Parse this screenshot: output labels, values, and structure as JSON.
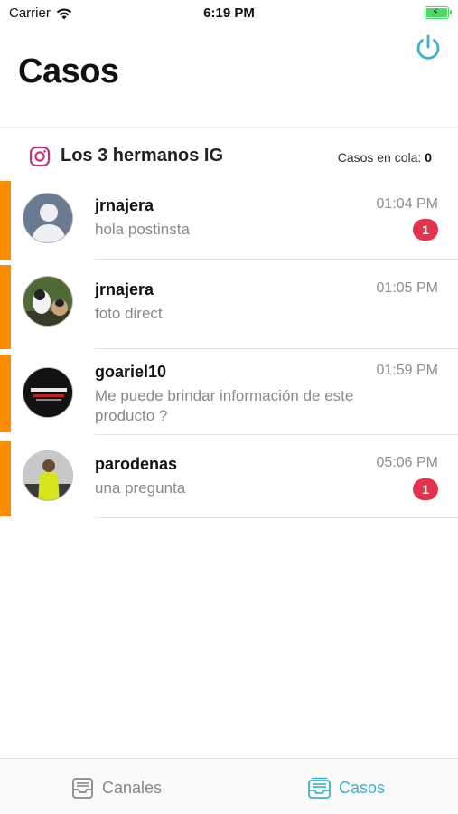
{
  "status_bar": {
    "carrier": "Carrier",
    "time": "6:19 PM"
  },
  "header": {
    "title": "Casos",
    "power_icon": "power-icon"
  },
  "channel": {
    "name": "Los 3 hermanos IG",
    "icon": "instagram-icon",
    "queue_label": "Casos en cola:",
    "queue_count": "0"
  },
  "cases": [
    {
      "name": "jrnajera",
      "time": "01:04 PM",
      "message": "hola postinsta",
      "badge": "1",
      "avatar": "default-avatar"
    },
    {
      "name": "jrnajera",
      "time": "01:05 PM",
      "message": "foto direct",
      "badge": "",
      "avatar": "dog-photo-avatar"
    },
    {
      "name": "goariel10",
      "time": "01:59 PM",
      "message": "Me puede brindar información de este producto ?",
      "badge": "",
      "avatar": "logo-photo-avatar"
    },
    {
      "name": "parodenas",
      "time": "05:06 PM",
      "message": "una pregunta",
      "badge": "1",
      "avatar": "person-photo-avatar"
    }
  ],
  "tabs": [
    {
      "label": "Canales",
      "icon": "inbox-icon",
      "active": false
    },
    {
      "label": "Casos",
      "icon": "inbox-stack-icon",
      "active": true
    }
  ],
  "colors": {
    "accent": "#3ab3c9",
    "case_bar": "#fb8c00",
    "badge": "#e2334c",
    "instagram": "#c13584"
  }
}
